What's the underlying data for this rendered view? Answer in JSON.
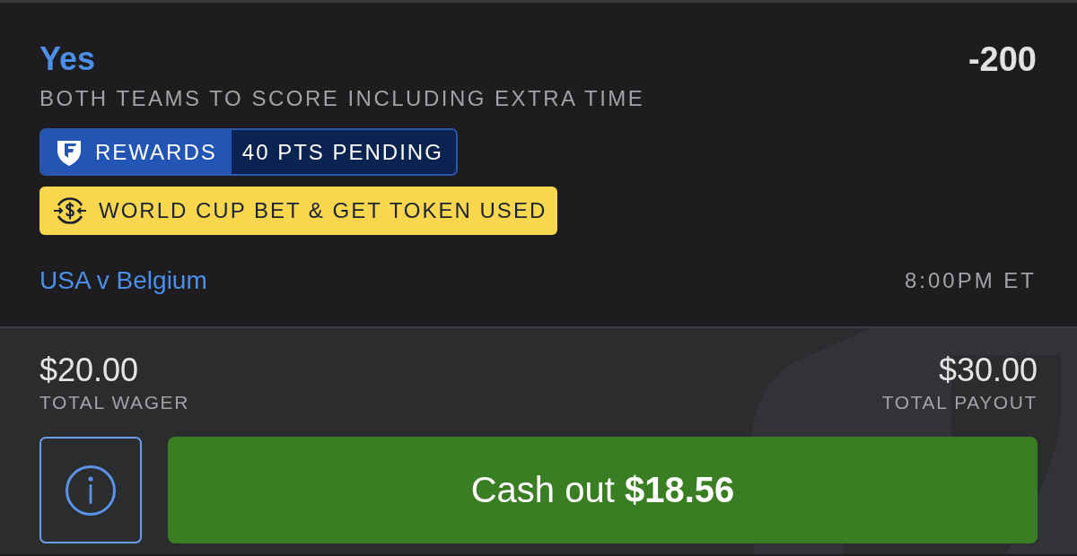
{
  "selection": {
    "name": "Yes",
    "odds": "-200",
    "market": "BOTH TEAMS TO SCORE INCLUDING EXTRA TIME"
  },
  "badges": [
    {
      "kind": "rewards",
      "label": "REWARDS",
      "value": "40 PTS PENDING"
    },
    {
      "kind": "promo",
      "label": "WORLD CUP BET & GET TOKEN USED"
    }
  ],
  "event": {
    "name": "USA v Belgium",
    "time": "8:00PM ET"
  },
  "totals": [
    {
      "amount": "$20.00",
      "label": "TOTAL WAGER"
    },
    {
      "amount": "$30.00",
      "label": "TOTAL PAYOUT"
    }
  ],
  "actions": {
    "cash_out": "Cash out **$18.56**"
  }
}
